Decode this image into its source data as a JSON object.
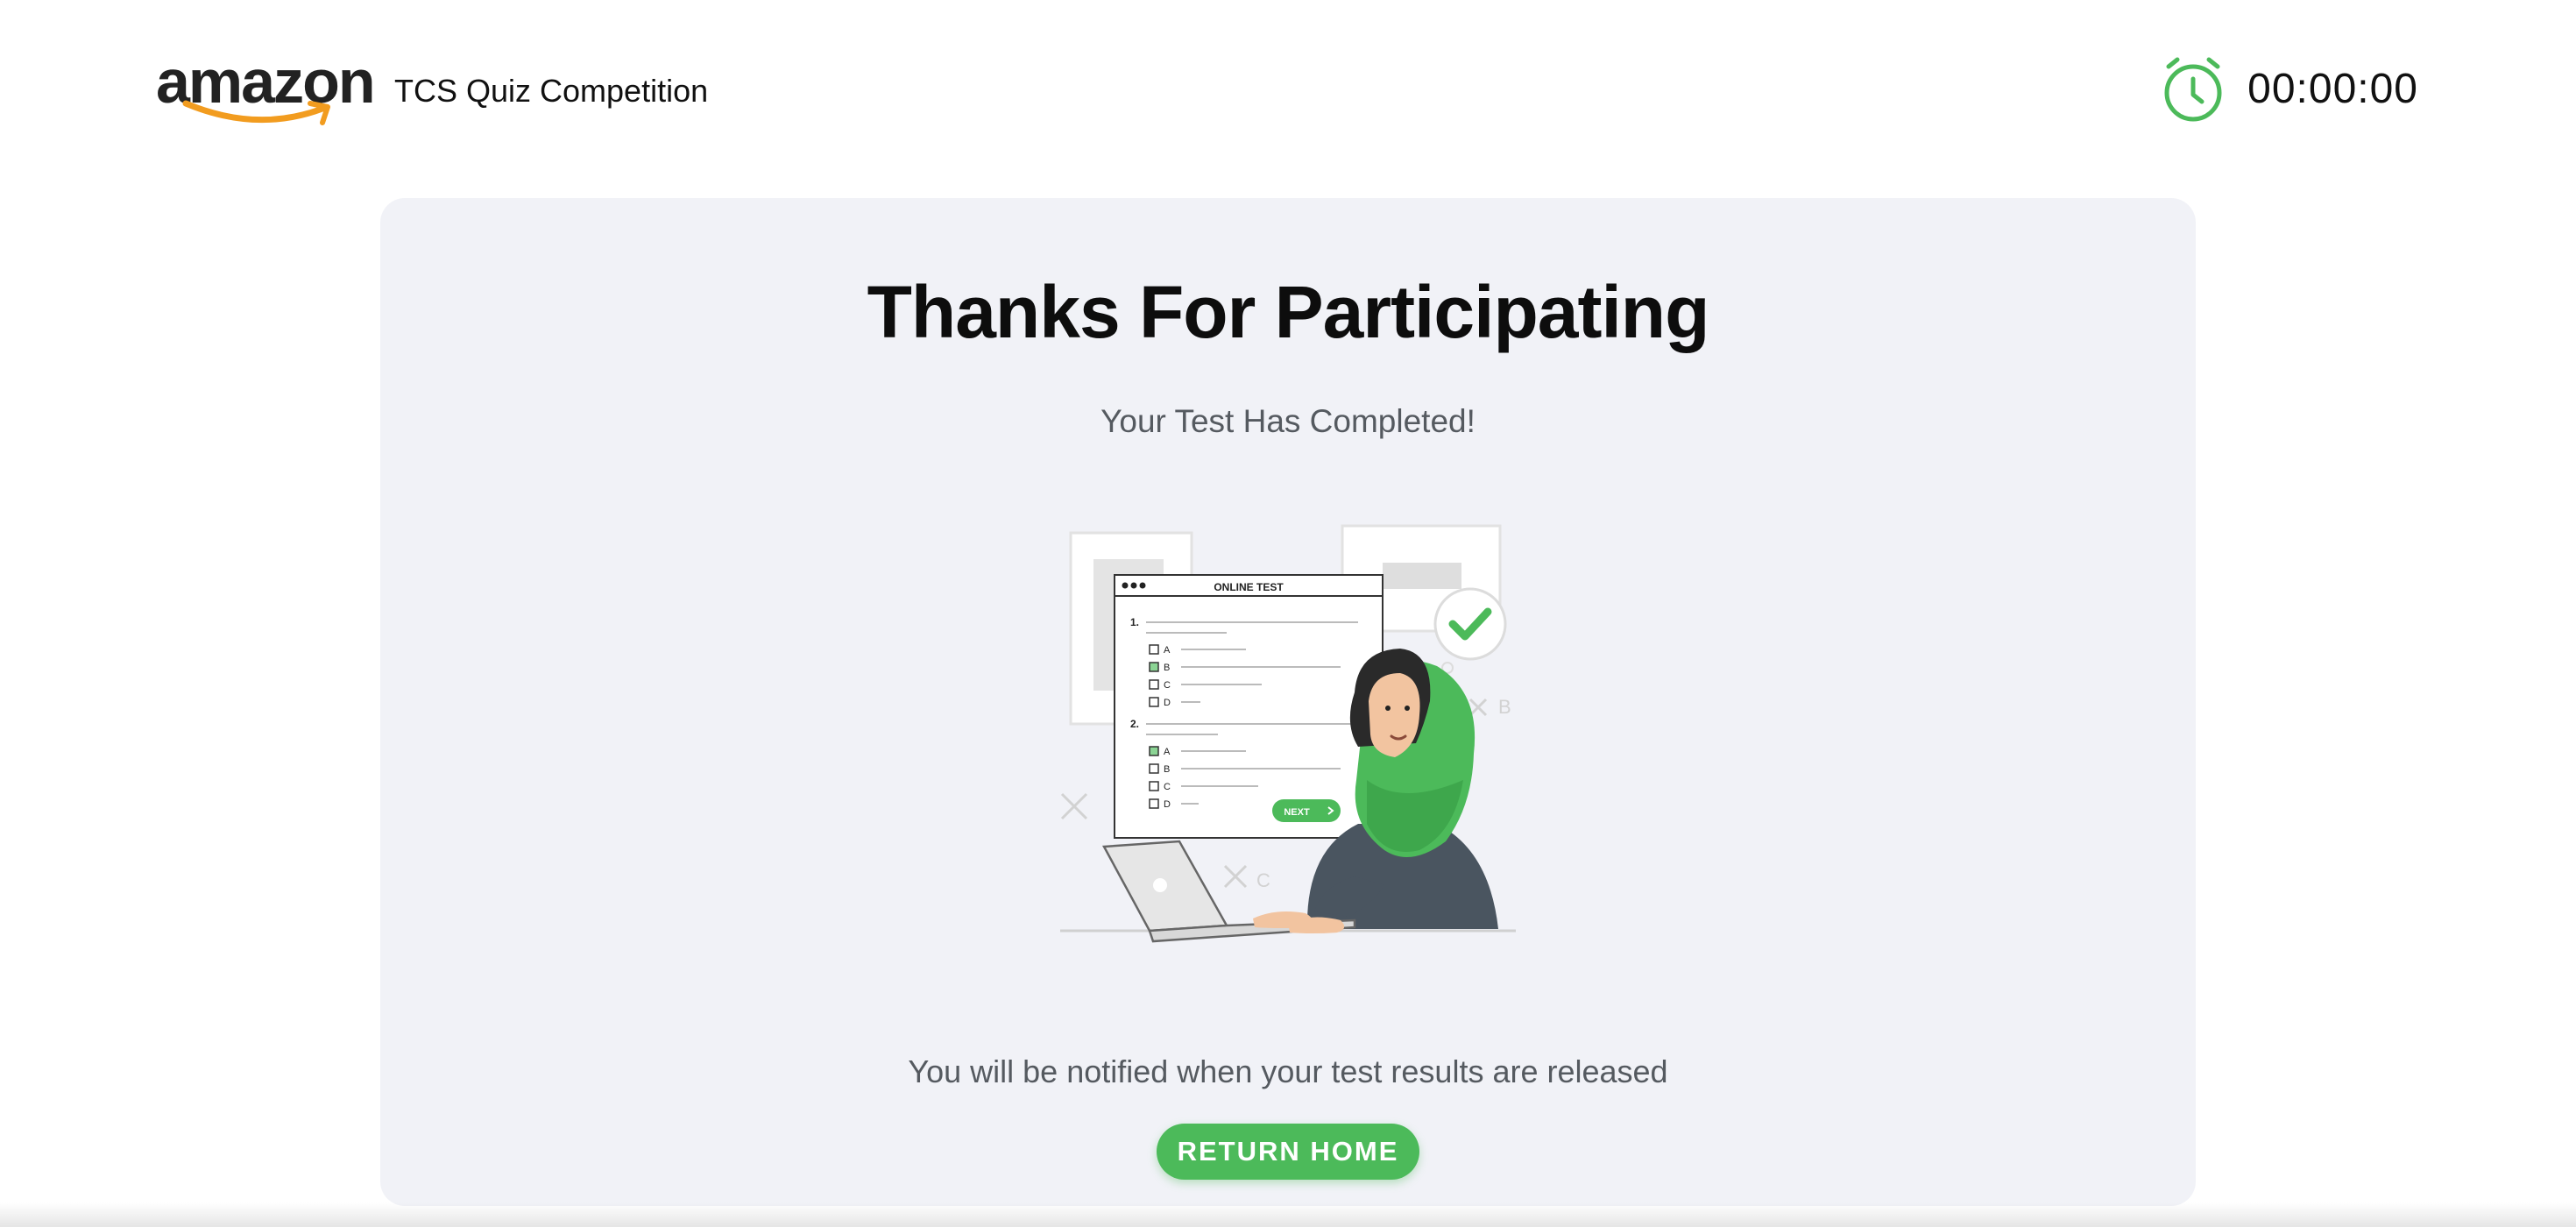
{
  "header": {
    "logo_text": "amazon",
    "app_title": "TCS Quiz Competition",
    "timer_value": "00:00:00",
    "timer_icon": "alarm-clock-icon"
  },
  "card": {
    "title": "Thanks For Participating",
    "subtitle": "Your Test Has Completed!",
    "illustration": {
      "panel_title": "ONLINE TEST",
      "q1_number": "1.",
      "q2_number": "2.",
      "options": [
        "A",
        "B",
        "C",
        "D"
      ],
      "next_label": "NEXT",
      "bg_letters": [
        "B",
        "C"
      ]
    },
    "notice": "You will be notified when your test results are released",
    "return_button_label": "RETURN HOME"
  },
  "colors": {
    "accent_green": "#4cba5a",
    "card_bg": "#f1f2f7",
    "text_dark": "#0d0d0d",
    "text_muted": "#555a60",
    "logo_orange": "#f29c1f"
  }
}
